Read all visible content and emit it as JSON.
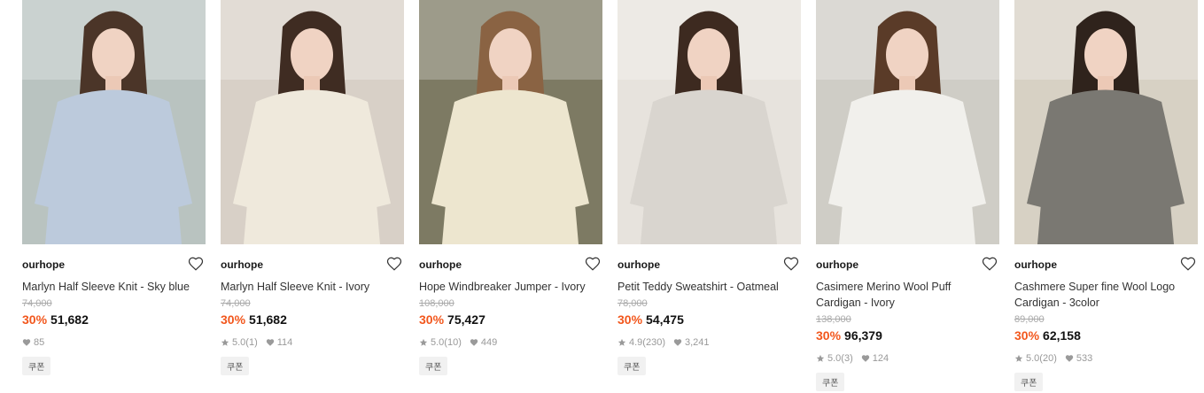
{
  "products": [
    {
      "brand": "ourhope",
      "title": "Marlyn Half Sleeve Knit - Sky blue",
      "original_price": "74,000",
      "discount": "30%",
      "price": "51,682",
      "rating": "",
      "review_count": "",
      "likes": "85",
      "coupon": "쿠폰",
      "colors": {
        "bg": "#b9c3c0",
        "garment": "#bccadc",
        "hair": "#4b3528"
      }
    },
    {
      "brand": "ourhope",
      "title": "Marlyn Half Sleeve Knit - Ivory",
      "original_price": "74,000",
      "discount": "30%",
      "price": "51,682",
      "rating": "5.0",
      "review_count": "(1)",
      "likes": "114",
      "coupon": "쿠폰",
      "colors": {
        "bg": "#d8d0c7",
        "garment": "#efe9dc",
        "hair": "#3f2c22"
      }
    },
    {
      "brand": "ourhope",
      "title": "Hope Windbreaker Jumper - Ivory",
      "original_price": "108,000",
      "discount": "30%",
      "price": "75,427",
      "rating": "5.0",
      "review_count": "(10)",
      "likes": "449",
      "coupon": "쿠폰",
      "colors": {
        "bg": "#7d7a63",
        "garment": "#ede6cf",
        "hair": "#8a6343"
      }
    },
    {
      "brand": "ourhope",
      "title": "Petit Teddy Sweatshirt - Oatmeal",
      "original_price": "78,000",
      "discount": "30%",
      "price": "54,475",
      "rating": "4.9",
      "review_count": "(230)",
      "likes": "3,241",
      "coupon": "쿠폰",
      "colors": {
        "bg": "#e7e3dd",
        "garment": "#d9d5cf",
        "hair": "#3d2a20"
      }
    },
    {
      "brand": "ourhope",
      "title": "Casimere Merino Wool Puff Cardigan - Ivory",
      "original_price": "138,000",
      "discount": "30%",
      "price": "96,379",
      "rating": "5.0",
      "review_count": "(3)",
      "likes": "124",
      "coupon": "쿠폰",
      "colors": {
        "bg": "#cfcdc6",
        "garment": "#f1f0ec",
        "hair": "#5a3b28"
      }
    },
    {
      "brand": "ourhope",
      "title": "Cashmere Super fine Wool Logo Cardigan - 3color",
      "original_price": "89,000",
      "discount": "30%",
      "price": "62,158",
      "rating": "5.0",
      "review_count": "(20)",
      "likes": "533",
      "coupon": "쿠폰",
      "colors": {
        "bg": "#d7d1c4",
        "garment": "#7a7872",
        "hair": "#2f231c"
      }
    }
  ],
  "icons": {
    "wish": "heart-outline-icon",
    "rating": "star-icon",
    "likes": "heart-filled-icon"
  },
  "accent_color": "#f2571d"
}
